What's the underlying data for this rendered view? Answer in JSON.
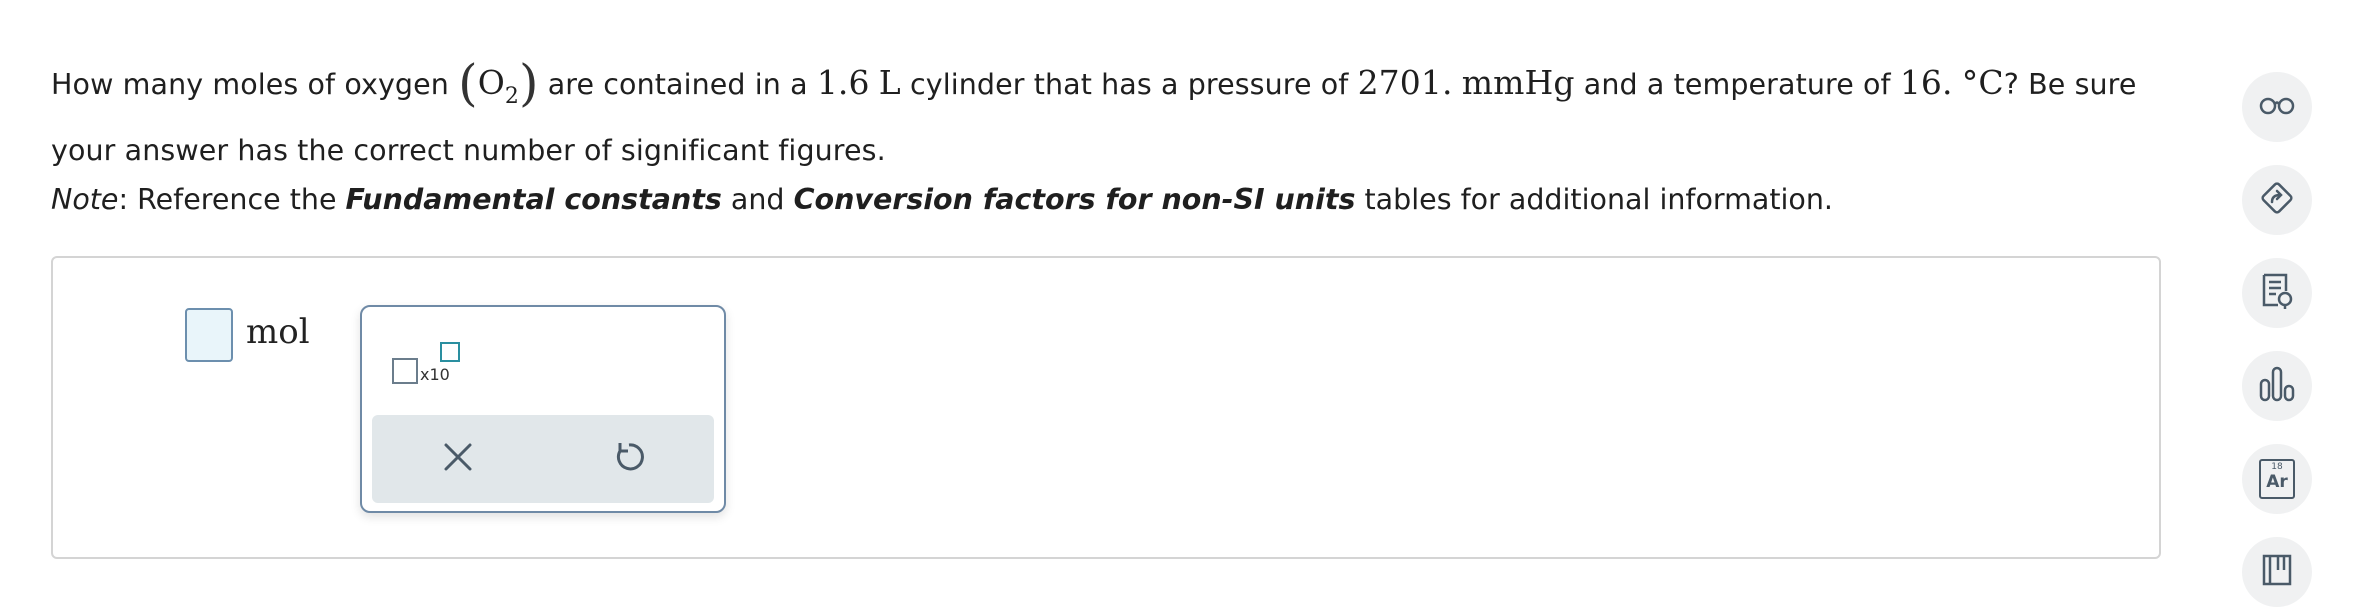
{
  "question": {
    "part1": "How many moles of oxygen ",
    "formula_element": "O",
    "formula_subscript": "2",
    "part2": " are contained in a ",
    "volume_value": "1.6",
    "volume_unit": "L",
    "part3": " cylinder that has a pressure of ",
    "pressure_value": "2701.",
    "pressure_unit": "mmHg",
    "part4": " and a temperature of ",
    "temperature_value": "16.",
    "temperature_unit": "°C",
    "part5": "? Be sure your answer has the correct number of significant figures."
  },
  "note": {
    "label": "Note",
    "colon": ": Reference the ",
    "table1": "Fundamental constants",
    "and": " and ",
    "table2": "Conversion factors for non-SI units",
    "end": " tables for additional information."
  },
  "answer": {
    "value": "",
    "unit": "mol"
  },
  "palette": {
    "sci_label": "x10",
    "clear_icon": "x-icon",
    "undo_icon": "undo-icon"
  },
  "sidebar_tools": [
    {
      "icon": "glasses-icon"
    },
    {
      "icon": "diamond-arrow-icon"
    },
    {
      "icon": "reference-sheet-icon"
    },
    {
      "icon": "bar-chart-icon"
    },
    {
      "icon": "periodic-table-icon"
    },
    {
      "icon": "book-icon"
    }
  ],
  "periodic_tile": {
    "number": "18",
    "symbol": "Ar"
  },
  "colors": {
    "input_border": "#6c8fae",
    "input_fill": "#e9f5fa",
    "palette_border": "#6f8aa6",
    "palette_bar": "#e1e7ea",
    "icon": "#4a5a68",
    "exponent_box": "#2a8fa0"
  }
}
